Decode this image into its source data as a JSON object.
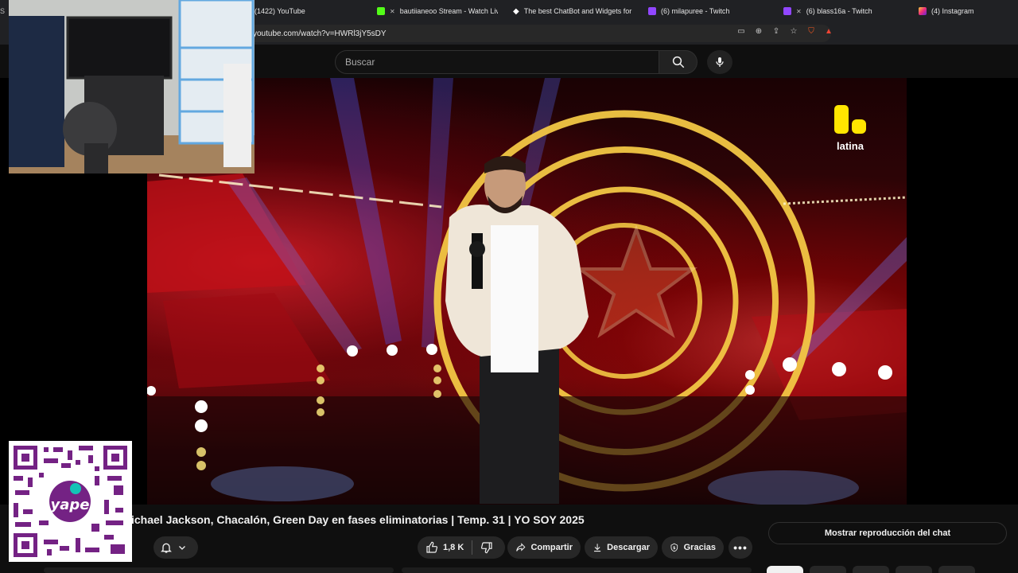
{
  "browser": {
    "tabs": [
      {
        "label": "(1422) YouTube",
        "favicon_color": "#ff0000"
      },
      {
        "label": "bautiianeoo Stream - Watch Live",
        "favicon_color": "#53fc18"
      },
      {
        "label": "The best ChatBot and Widgets for Ki",
        "favicon_color": "#ffffff"
      },
      {
        "label": "(6) milapuree - Twitch",
        "favicon_color": "#9146ff"
      },
      {
        "label": "(6) blass16a - Twitch",
        "favicon_color": "#9146ff"
      },
      {
        "label": "(4) Instagram",
        "favicon_color": "#e1306c"
      }
    ],
    "url": "youtube.com/watch?v=HWRl3jY5sDY"
  },
  "youtube": {
    "search_placeholder": "Buscar",
    "video_title": "ichael Jackson, Chacalón, Green Day en fases eliminatorias | Temp. 31 | YO SOY 2025",
    "channel_logo_text": "latina",
    "actions": {
      "likes": "1,8 K",
      "share": "Compartir",
      "download": "Descargar",
      "thanks": "Gracias"
    },
    "chat_replay": "Mostrar reproducción del chat"
  },
  "overlay": {
    "qr_brand": "yape"
  },
  "colors": {
    "background": "#0f0f0f",
    "pill": "#272727",
    "latina_yellow": "#ffe600",
    "yape_purple": "#742284",
    "ring_gold": "#f2c744"
  }
}
